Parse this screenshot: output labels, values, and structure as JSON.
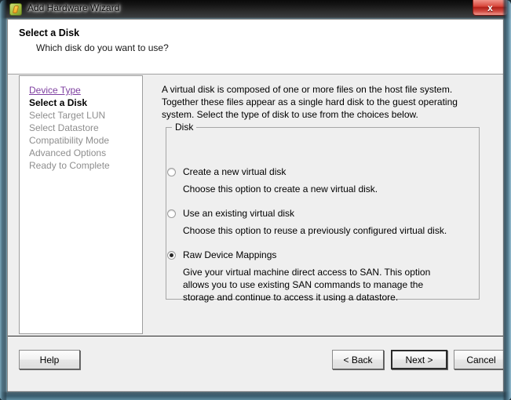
{
  "window": {
    "title": "Add Hardware Wizard",
    "icon": "wizard-icon",
    "close_label": "x"
  },
  "header": {
    "title": "Select a Disk",
    "subtitle": "Which disk do you want to use?"
  },
  "sidebar": {
    "items": [
      {
        "label": "Device Type",
        "state": "link"
      },
      {
        "label": "Select a Disk",
        "state": "current"
      },
      {
        "label": "Select Target LUN",
        "state": "disabled"
      },
      {
        "label": "Select Datastore",
        "state": "disabled"
      },
      {
        "label": "Compatibility Mode",
        "state": "disabled"
      },
      {
        "label": "Advanced Options",
        "state": "disabled"
      },
      {
        "label": "Ready to Complete",
        "state": "disabled"
      }
    ]
  },
  "content": {
    "intro": "A virtual disk is composed of one or more files on the host file system. Together these files appear as a single hard disk to the guest operating system. Select the type of disk to use from the choices below.",
    "group_label": "Disk",
    "options": [
      {
        "label": "Create a new virtual disk",
        "description": "Choose this option to create a new virtual disk.",
        "selected": false
      },
      {
        "label": "Use an existing virtual disk",
        "description": "Choose this option to reuse a previously configured virtual disk.",
        "selected": false
      },
      {
        "label": "Raw Device Mappings",
        "description": "Give your virtual machine direct access to SAN. This option allows you to use existing SAN commands to manage the storage and continue to access it using a datastore.",
        "selected": true
      }
    ]
  },
  "footer": {
    "help_label": "Help",
    "back_label": "< Back",
    "next_label": "Next >",
    "cancel_label": "Cancel",
    "default_button": "Next >"
  },
  "colors": {
    "link": "#7e3fa0",
    "disabled_text": "#8e8e8e",
    "close_button": "#b02018",
    "panel_bg": "#efefef",
    "sidebar_bg": "#ffffff"
  }
}
